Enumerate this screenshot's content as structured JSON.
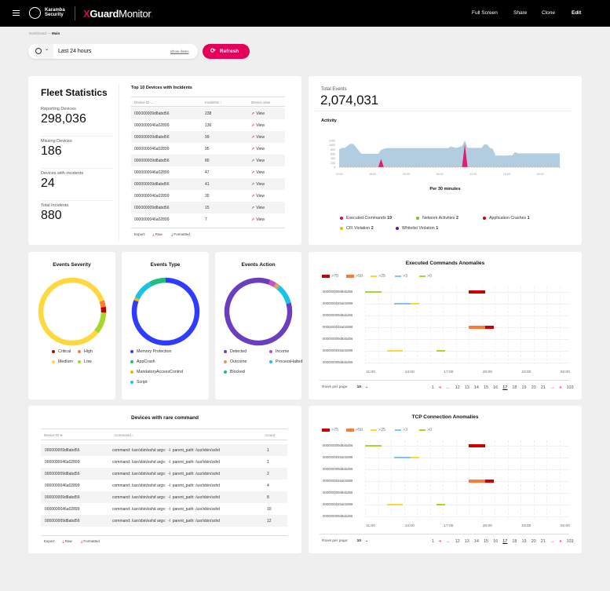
{
  "header": {
    "brand_line1": "Karamba",
    "brand_line2": "Security",
    "product_x": "X",
    "product_guard": "Guard",
    "product_monitor": "Monitor",
    "nav": [
      "Full Screen",
      "Share",
      "Clone",
      "Edit"
    ]
  },
  "breadcrumb": {
    "parent": "Dashboard",
    "separator": "—",
    "current": "Main"
  },
  "timebar": {
    "value": "Last 24 hours",
    "show_dates": "Show dates",
    "refresh": "Refresh"
  },
  "colors": {
    "accent": "#e5005a"
  },
  "fleet": {
    "title": "Fleet Statistics",
    "stats": [
      {
        "label": "Reporting Devices",
        "value": "298,036"
      },
      {
        "label": "Missing Devices",
        "value": "186"
      },
      {
        "label": "Devices with incidents",
        "value": "24"
      },
      {
        "label": "Total Incidents",
        "value": "880"
      }
    ]
  },
  "top10": {
    "title": "Top 10 Devices with Incidents",
    "columns": [
      "Device ID",
      "Incidents",
      "Device view"
    ],
    "rows": [
      [
        "000000009d8abd56",
        "238",
        "View"
      ],
      [
        "0000000046a02899",
        "136",
        "View"
      ],
      [
        "000000009d8abd56",
        "99",
        "View"
      ],
      [
        "0000000046a02899",
        "95",
        "View"
      ],
      [
        "000000009d8abd56",
        "80",
        "View"
      ],
      [
        "0000000046a02899",
        "47",
        "View"
      ],
      [
        "000000009d8abd56",
        "41",
        "View"
      ],
      [
        "0000000046a02899",
        "30",
        "View"
      ],
      [
        "000000009d8abd56",
        "15",
        "View"
      ],
      [
        "0000000046a02899",
        "7",
        "View"
      ]
    ],
    "export_label": "Export:",
    "export_raw": "Raw",
    "export_formatted": "Formatted"
  },
  "events": {
    "total_label": "Total Events",
    "total_value": "2,074,031",
    "activity_title": "Activity",
    "xlabel": "Per 30 minutes",
    "legend": [
      {
        "label": "Executed Commands",
        "count": "19",
        "color": "#e5005a"
      },
      {
        "label": "Network Activities",
        "count": "2",
        "color": "#7cbf2a"
      },
      {
        "label": "Application Crashes",
        "count": "1",
        "color": "#cc0000"
      },
      {
        "label": "CFI Violation",
        "count": "2",
        "color": "#f0b800"
      },
      {
        "label": "Whitelist Violation",
        "count": "1",
        "color": "#6a0dad"
      }
    ]
  },
  "chart_data": [
    {
      "type": "area",
      "title": "Activity",
      "xlabel": "Per 30 minutes",
      "ylim": [
        0,
        1200
      ],
      "yticks": [
        0,
        200,
        400,
        600,
        800,
        1000,
        1200
      ],
      "xticks": [
        "12:00",
        "18:00",
        "00:00",
        "06:00",
        "12:00",
        "18:00",
        "00:00"
      ],
      "series": [
        {
          "role": "total",
          "color": "#b3cde0",
          "points": [
            [
              "12:00",
              800
            ],
            [
              "12:30",
              870
            ],
            [
              "13:00",
              870
            ],
            [
              "14:00",
              1050
            ],
            [
              "14:30",
              1050
            ],
            [
              "16:00",
              600
            ],
            [
              "19:00",
              600
            ],
            [
              "19:30",
              780
            ],
            [
              "20:30",
              860
            ],
            [
              "07:30",
              860
            ],
            [
              "08:00",
              930
            ],
            [
              "09:00",
              870
            ],
            [
              "10:00",
              950
            ],
            [
              "10:30",
              1200
            ],
            [
              "11:00",
              870
            ],
            [
              "13:30",
              870
            ],
            [
              "14:00",
              1030
            ],
            [
              "14:30",
              1030
            ],
            [
              "15:00",
              860
            ],
            [
              "15:30",
              830
            ],
            [
              "16:00",
              520
            ],
            [
              "18:00",
              520
            ],
            [
              "18:30",
              540
            ],
            [
              "19:00",
              530
            ],
            [
              "19:30",
              680
            ],
            [
              "20:00",
              620
            ],
            [
              "03:30",
              620
            ]
          ]
        },
        {
          "name": "Executed Commands",
          "color": "#e5005a",
          "points": [
            [
              "12:00",
              0
            ],
            [
              "19:00",
              0
            ],
            [
              "19:30",
              370
            ],
            [
              "20:00",
              0
            ],
            [
              "10:00",
              0
            ],
            [
              "10:30",
              1050
            ],
            [
              "11:00",
              0
            ],
            [
              "03:30",
              0
            ]
          ]
        }
      ]
    },
    {
      "type": "pie",
      "title": "Events Severity",
      "start_deg": 70,
      "slices": [
        {
          "name": "High",
          "value": 3.3,
          "color": "#ff7a33"
        },
        {
          "name": "Critical",
          "value": 2.8,
          "color": "#c00000"
        },
        {
          "name": "Low",
          "value": 10.5,
          "color": "#a6d72c"
        },
        {
          "name": "Medium",
          "value": 83.4,
          "color": "#ffd83d"
        }
      ],
      "legend": [
        "Critical",
        "High",
        "Medium",
        "Low"
      ]
    },
    {
      "type": "pie",
      "title": "Events Type",
      "start_deg": 0,
      "slices": [
        {
          "name": "Memory Protection",
          "value": 80.5,
          "color": "#2f3cff"
        },
        {
          "name": "MandatoryAccessControl",
          "value": 1.5,
          "color": "#f0b800"
        },
        {
          "name": "Script",
          "value": 10,
          "color": "#19c3e6"
        },
        {
          "name": "AppCrash",
          "value": 8,
          "color": "#1dbf7a"
        }
      ],
      "legend": [
        "Memory Protection",
        "AppCrash",
        "MandatoryAccessControl",
        "Script"
      ]
    },
    {
      "type": "pie",
      "title": "Events Action",
      "start_deg": 20,
      "slices": [
        {
          "name": "Income",
          "value": 3.3,
          "color": "#c050d0"
        },
        {
          "name": "Outcome",
          "value": 2.2,
          "color": "#d9a060"
        },
        {
          "name": "ProcessHalted",
          "value": 9.7,
          "color": "#19c3e6"
        },
        {
          "name": "Detected",
          "value": 84.8,
          "color": "#6a3ebf"
        },
        {
          "name": "Blocked",
          "value": 0,
          "color": "#1dbf7a"
        }
      ],
      "legend": [
        "Detected",
        "Income",
        "Outcome",
        "ProcessHalted",
        "Blocked"
      ]
    },
    {
      "type": "timeline",
      "title": "Executed Commands Anomalies",
      "xlim": [
        "10:30",
        "02:15"
      ],
      "xticks": [
        "11:00",
        "14:00",
        "17:00",
        "20:00",
        "23:00",
        "02:00"
      ],
      "legend": [
        {
          "label": ">75",
          "color": "#cc0000"
        },
        {
          "label": ">50",
          "color": "#ff7a33"
        },
        {
          "label": ">25",
          "color": "#ffd633"
        },
        {
          "label": ">3",
          "color": "#80c4f0"
        },
        {
          "label": ">0",
          "color": "#a6d72c"
        }
      ],
      "rows": [
        "000000009d8abd56",
        "0000000046a02899",
        "000000009d8abd56",
        "0000000046a02899",
        "000000009d8abd56",
        "0000000046a02899",
        "000000009d8abd56"
      ],
      "bars": [
        {
          "row": 0,
          "level": ">0",
          "start": "10:30",
          "end": "11:45"
        },
        {
          "row": 0,
          "level": ">75",
          "start": "18:30",
          "end": "19:45"
        },
        {
          "row": 1,
          "level": ">3",
          "start": "12:45",
          "end": "14:00"
        },
        {
          "row": 1,
          "level": ">25",
          "start": "14:00",
          "end": "14:40"
        },
        {
          "row": 3,
          "level": ">50",
          "start": "18:30",
          "end": "19:45"
        },
        {
          "row": 3,
          "level": ">75",
          "start": "19:45",
          "end": "20:25"
        },
        {
          "row": 5,
          "level": ">25",
          "start": "12:10",
          "end": "13:25"
        },
        {
          "row": 5,
          "level": ">0",
          "start": "16:00",
          "end": "16:40"
        }
      ]
    },
    {
      "type": "timeline",
      "title": "TCP Connection Anomalies",
      "xlim": [
        "10:30",
        "02:15"
      ],
      "xticks": [
        "11:00",
        "14:00",
        "17:00",
        "20:00",
        "23:00",
        "02:00"
      ],
      "legend": [
        {
          "label": ">75",
          "color": "#cc0000"
        },
        {
          "label": ">50",
          "color": "#ff7a33"
        },
        {
          "label": ">25",
          "color": "#ffd633"
        },
        {
          "label": ">3",
          "color": "#80c4f0"
        },
        {
          "label": ">0",
          "color": "#a6d72c"
        }
      ],
      "rows": [
        "000000009d8abd56",
        "0000000046a02899",
        "000000009d8abd56",
        "0000000046a02899",
        "000000009d8abd56",
        "0000000046a02899",
        "000000009d8abd56"
      ],
      "bars": [
        {
          "row": 0,
          "level": ">0",
          "start": "10:30",
          "end": "11:45"
        },
        {
          "row": 0,
          "level": ">75",
          "start": "18:30",
          "end": "19:45"
        },
        {
          "row": 1,
          "level": ">3",
          "start": "12:45",
          "end": "14:00"
        },
        {
          "row": 1,
          "level": ">25",
          "start": "14:00",
          "end": "14:40"
        },
        {
          "row": 3,
          "level": ">50",
          "start": "18:30",
          "end": "19:45"
        },
        {
          "row": 3,
          "level": ">75",
          "start": "19:45",
          "end": "20:25"
        },
        {
          "row": 5,
          "level": ">25",
          "start": "12:10",
          "end": "13:25"
        },
        {
          "row": 5,
          "level": ">0",
          "start": "16:00",
          "end": "16:40"
        }
      ]
    }
  ],
  "pagination": {
    "rows_label": "Rows per page:",
    "rows_value": "10",
    "pages": [
      "1",
      "«",
      "←",
      "12",
      "13",
      "14",
      "15",
      "16",
      "17",
      "18",
      "19",
      "20",
      "21",
      "→",
      "»",
      "103"
    ],
    "current": "17"
  },
  "rare": {
    "title": "Devices with rare command",
    "columns": [
      "Device ID",
      "Command",
      "Count"
    ],
    "rows": [
      [
        "000000009d8abd56",
        "command: /usr/sbin/sshd args:  -I  parent_path: /usr/sbin/sshd",
        "1"
      ],
      [
        "0000000046a02899",
        "command: /usr/sbin/sshd args:  -I  parent_path: /usr/sbin/sshd",
        "1"
      ],
      [
        "000000009d8abd56",
        "command: /usr/sbin/sshd args:  -I  parent_path: /usr/sbin/sshd",
        "2"
      ],
      [
        "0000000046a02899",
        "command: /usr/sbin/sshd args:  -I  parent_path: /usr/sbin/sshd",
        "4"
      ],
      [
        "000000009d8abd56",
        "command: /usr/sbin/sshd args:  -I  parent_path: /usr/sbin/sshd",
        "8"
      ],
      [
        "0000000046a02899",
        "command: /usr/sbin/sshd args:  -I  parent_path: /usr/sbin/sshd",
        "10"
      ],
      [
        "000000009d8abd56",
        "command: /usr/sbin/sshd args:  -I  parent_path: /usr/sbin/sshd",
        "12"
      ]
    ],
    "export_label": "Export:",
    "export_raw": "Raw",
    "export_formatted": "Formatted"
  }
}
